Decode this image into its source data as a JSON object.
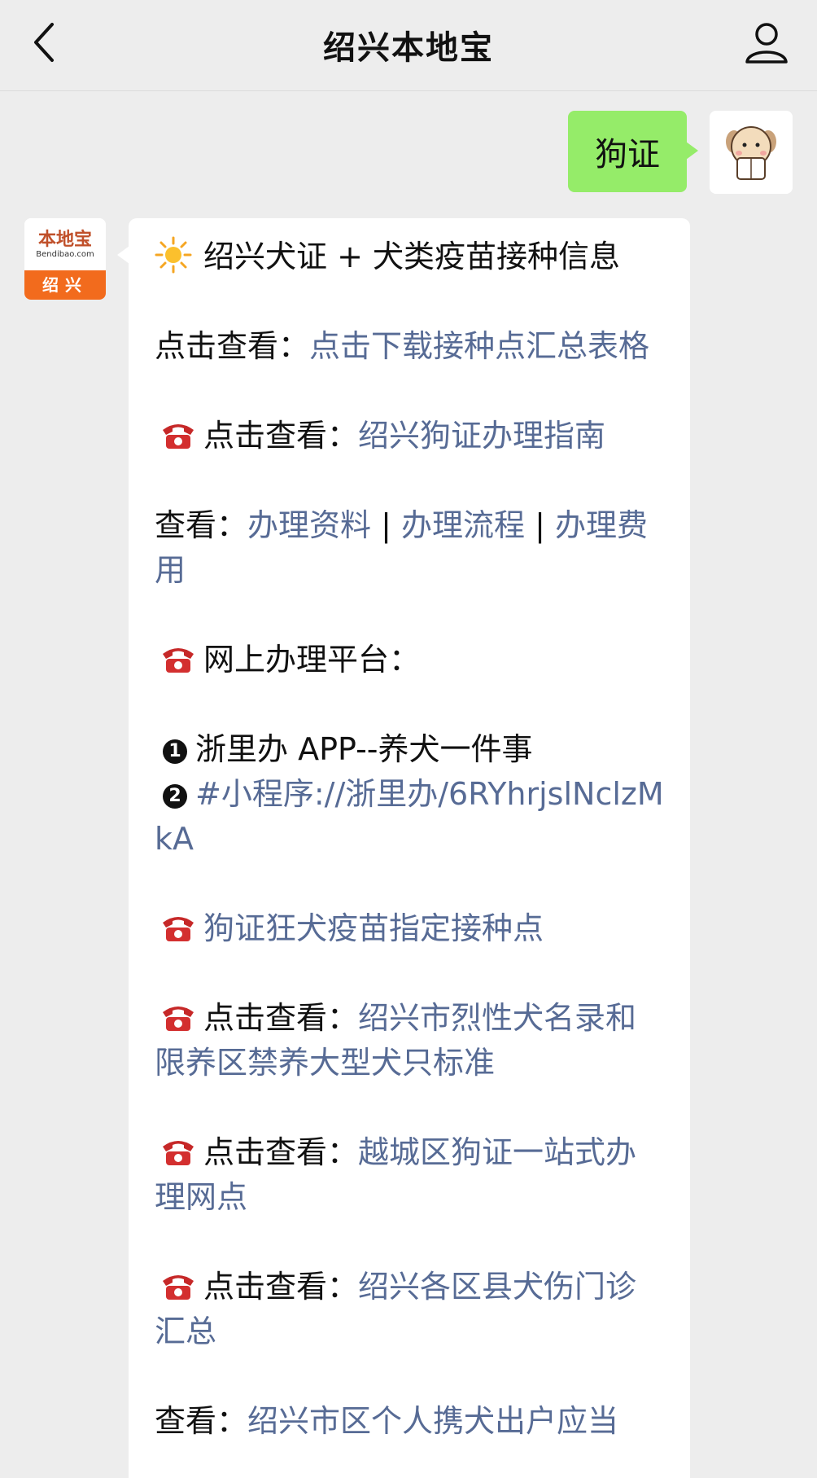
{
  "header": {
    "title": "绍兴本地宝",
    "back_icon": "chevron-left-icon",
    "user_icon": "user-icon"
  },
  "outgoing": {
    "text": "狗证",
    "bubble_color": "#95ec69"
  },
  "incoming_avatar": {
    "brand": "本地宝",
    "url": "Bendibao.com",
    "city": "绍兴"
  },
  "message": {
    "title": "绍兴犬证 + 犬类疫苗接种信息",
    "l1_prefix": "点击查看：",
    "l1_link": "点击下载接种点汇总表格",
    "l2_prefix": "点击查看：",
    "l2_link": "绍兴狗证办理指南",
    "l3_prefix": "查看：",
    "l3_link1": "办理资料",
    "sep1": " | ",
    "l3_link2": "办理流程",
    "sep2": " | ",
    "l3_link3": "办理费用",
    "l4_text": "网上办理平台：",
    "l5_num": "1",
    "l5_text": "浙里办 APP--养犬一件事",
    "l6_num": "2",
    "l6_link": "#小程序://浙里办/6RYhrjslNclzMkA",
    "l7_link": "狗证狂犬疫苗指定接种点",
    "l8_prefix": "点击查看：",
    "l8_link": "绍兴市烈性犬名录和限养区禁养大型犬只标准",
    "l9_prefix": "点击查看：",
    "l9_link": "越城区狗证一站式办理网点",
    "l10_prefix": "点击查看：",
    "l10_link": "绍兴各区县犬伤门诊汇总",
    "l11_prefix": "查看：",
    "l11_link": "绍兴市区个人携犬出户应当"
  },
  "colors": {
    "link": "#576b95",
    "background": "#ededed",
    "avatar_orange": "#f26b1d"
  }
}
